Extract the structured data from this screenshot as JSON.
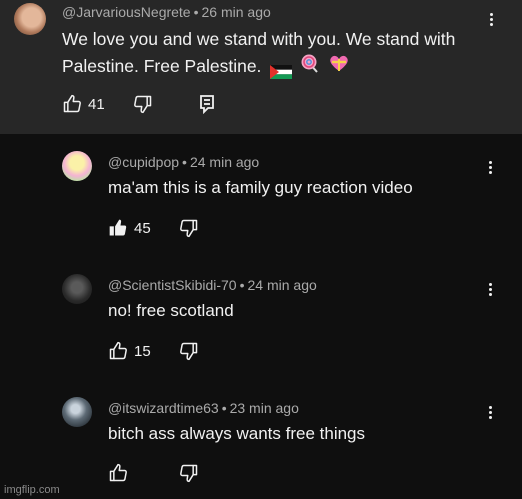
{
  "comments": [
    {
      "handle": "@JarvariousNegrete",
      "time": "26 min ago",
      "text": "We love you and we stand with you. We stand with",
      "text2": "Palestine. Free Palestine.",
      "likes": "41",
      "icons": [
        "palestine-flag-icon",
        "lollipop-icon",
        "heart-ribbon-icon"
      ]
    },
    {
      "handle": "@cupidpop",
      "time": "24 min ago",
      "text": "ma'am this is a family guy reaction video",
      "likes": "45"
    },
    {
      "handle": "@ScientistSkibidi-70",
      "time": "24 min ago",
      "text": "no! free scotland",
      "likes": "15"
    },
    {
      "handle": "@itswizardtime63",
      "time": "23 min ago",
      "text": "bitch ass always wants free things",
      "likes": ""
    }
  ],
  "separator": "•",
  "watermark": "imgflip.com",
  "colors": {
    "panel": "#272727",
    "background": "#0f0f0f",
    "text": "#f1f1f1",
    "meta": "#aaaaaa"
  }
}
